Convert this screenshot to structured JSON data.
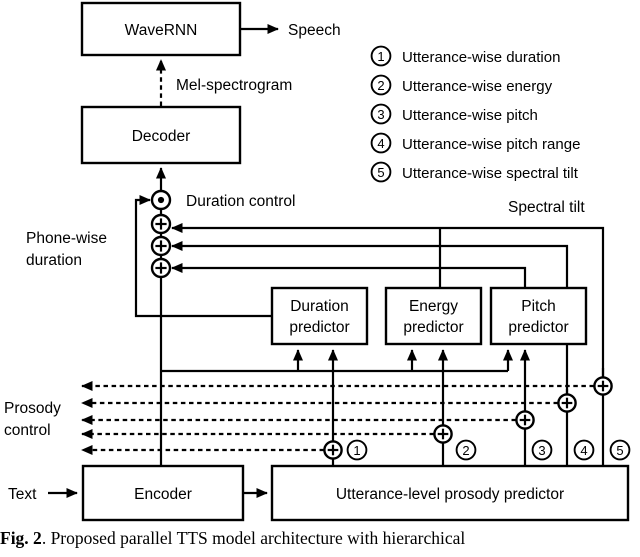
{
  "figure": {
    "caption_label": "Fig. 2",
    "caption_text": ". Proposed parallel TTS model architecture with hierarchical"
  },
  "blocks": {
    "wavernn": "WaveRNN",
    "decoder": "Decoder",
    "encoder": "Encoder",
    "utterance_predictor": "Utterance-level prosody predictor",
    "duration_predictor_line1": "Duration",
    "duration_predictor_line2": "predictor",
    "energy_predictor_line1": "Energy",
    "energy_predictor_line2": "predictor",
    "pitch_predictor_line1": "Pitch",
    "pitch_predictor_line2": "predictor"
  },
  "edge_labels": {
    "speech": "Speech",
    "mel_spectrogram": "Mel-spectrogram",
    "duration_control": "Duration control",
    "phone_wise_line1": "Phone-wise",
    "phone_wise_line2": "duration",
    "spectral_tilt": "Spectral tilt",
    "prosody_control_line1": "Prosody",
    "prosody_control_line2": "control",
    "text": "Text"
  },
  "operators": {
    "multiply_glyph": "multiply-circle-operator",
    "add_glyph": "plus-circle-operator"
  },
  "markers": {
    "one": "1",
    "two": "2",
    "three": "3",
    "four": "4",
    "five": "5"
  },
  "legend": {
    "items": [
      {
        "num": "1",
        "label": "Utterance-wise duration"
      },
      {
        "num": "2",
        "label": "Utterance-wise energy"
      },
      {
        "num": "3",
        "label": "Utterance-wise pitch"
      },
      {
        "num": "4",
        "label": "Utterance-wise pitch range"
      },
      {
        "num": "5",
        "label": "Utterance-wise spectral tilt"
      }
    ]
  },
  "colors": {
    "stroke": "#000000",
    "background": "#ffffff"
  }
}
